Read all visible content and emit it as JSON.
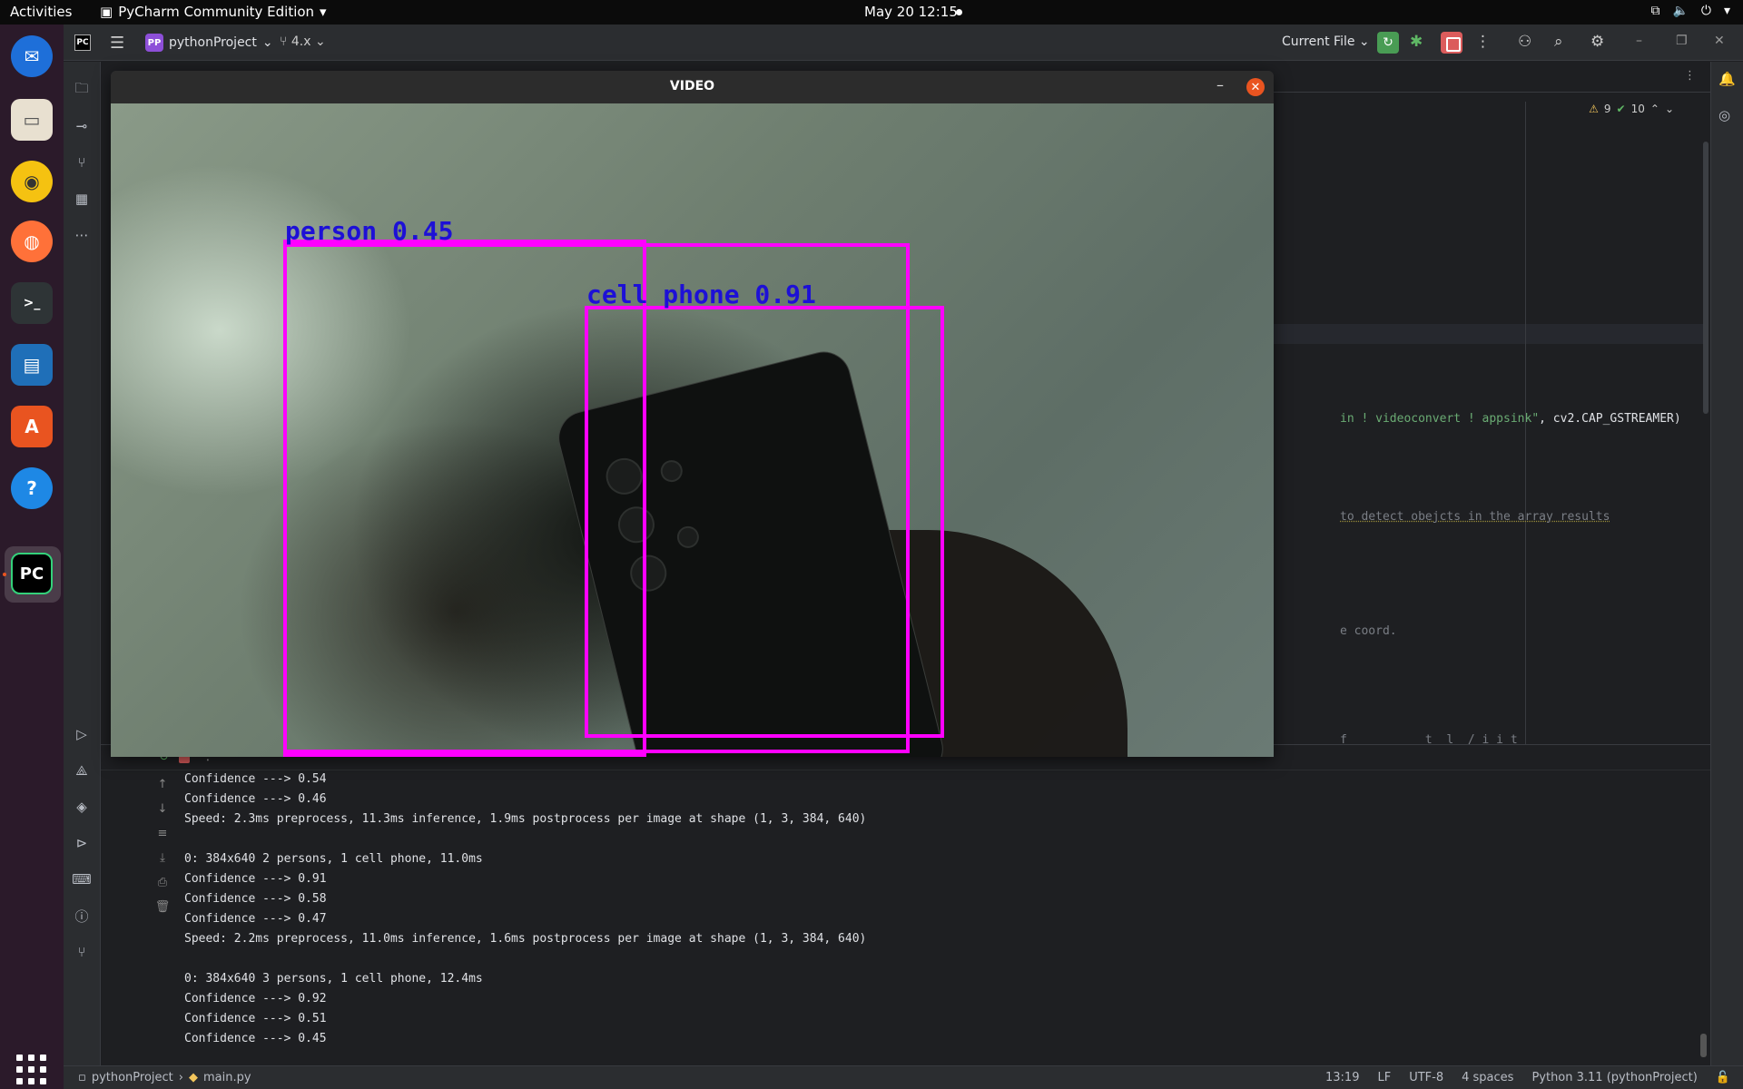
{
  "topbar": {
    "activities": "Activities",
    "app_name": "PyCharm Community Edition",
    "clock": "May 20  12:15"
  },
  "dock": {
    "items": [
      "thunderbird-icon",
      "files-icon",
      "rhythmbox-icon",
      "firefox-icon",
      "terminal-icon",
      "writer-icon",
      "app-center-icon",
      "help-icon",
      "pycharm-icon"
    ],
    "colors": {
      "thunderbird": "#1e6fd9",
      "files": "#e8e0d0",
      "rhythmbox": "#f5c211",
      "firefox": "#ff7139",
      "terminal": "#2e3436",
      "writer": "#1f6fb8",
      "appcenter": "#e95420",
      "help": "#1e88e5",
      "pycharm": "#000000"
    },
    "pycharm_label": "PC"
  },
  "ide": {
    "logo": "PC",
    "project_badge": "PP",
    "project_name": "pythonProject",
    "branch": "4.x",
    "run_config": "Current File"
  },
  "editor": {
    "warnings": "9",
    "ok_count": "10",
    "lines": [
      {
        "text": "in ! videoconvert ! appsink\"",
        "suffix": ", cv2.CAP_GSTREAMER)"
      },
      {
        "comment": "to detect obejcts in the array results"
      },
      {
        "plain": "e coord."
      },
      {
        "plain": "f           t  l  / i i t"
      }
    ]
  },
  "video": {
    "title": "VIDEO",
    "detections": [
      {
        "label": "person 0.45"
      },
      {
        "label": "cell phone 0.91"
      }
    ]
  },
  "console": {
    "lines": [
      "Confidence ---> 0.54",
      "Confidence ---> 0.46",
      "Speed: 2.3ms preprocess, 11.3ms inference, 1.9ms postprocess per image at shape (1, 3, 384, 640)",
      "",
      "0: 384x640 2 persons, 1 cell phone, 11.0ms",
      "Confidence ---> 0.91",
      "Confidence ---> 0.58",
      "Confidence ---> 0.47",
      "Speed: 2.2ms preprocess, 11.0ms inference, 1.6ms postprocess per image at shape (1, 3, 384, 640)",
      "",
      "0: 384x640 3 persons, 1 cell phone, 12.4ms",
      "Confidence ---> 0.92",
      "Confidence ---> 0.51",
      "Confidence ---> 0.45"
    ]
  },
  "status": {
    "project": "pythonProject",
    "file": "main.py",
    "position": "13:19",
    "line_sep": "LF",
    "encoding": "UTF-8",
    "indent": "4 spaces",
    "interpreter": "Python 3.11 (pythonProject)"
  }
}
